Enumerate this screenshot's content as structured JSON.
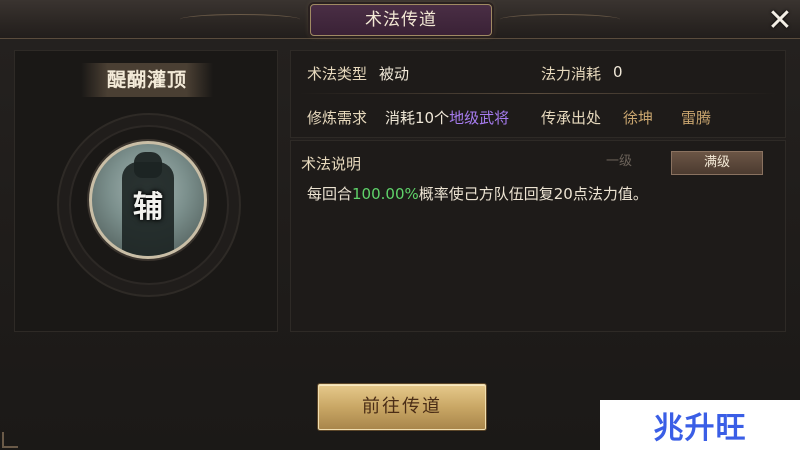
{
  "window": {
    "title": "术法传道",
    "close_icon": "close-icon"
  },
  "skill": {
    "name": "醍醐灌顶",
    "portrait_char": "辅"
  },
  "info": {
    "type_label": "术法类型",
    "type_value": "被动",
    "cost_label": "法力消耗",
    "cost_value": "0",
    "req_label": "修炼需求",
    "req_prefix": "消耗10个",
    "req_highlight": "地级武将",
    "source_label": "传承出处",
    "source_1": "徐坤",
    "source_2": "雷腾"
  },
  "description": {
    "title": "术法说明",
    "tab_level1": "一级",
    "tab_max": "满级",
    "text_before": "每回合",
    "text_percent": "100.00%",
    "text_after": "概率使己方队伍回复20点法力值。"
  },
  "actions": {
    "go_button": "前往传道"
  },
  "watermark": {
    "text": "兆升旺"
  },
  "colors": {
    "highlight_purple": "#a77cf0",
    "highlight_green": "#5fd36a",
    "link_gold": "#c8a46e",
    "button_gold": "#c9a765",
    "watermark_blue": "#3a5ee6"
  }
}
